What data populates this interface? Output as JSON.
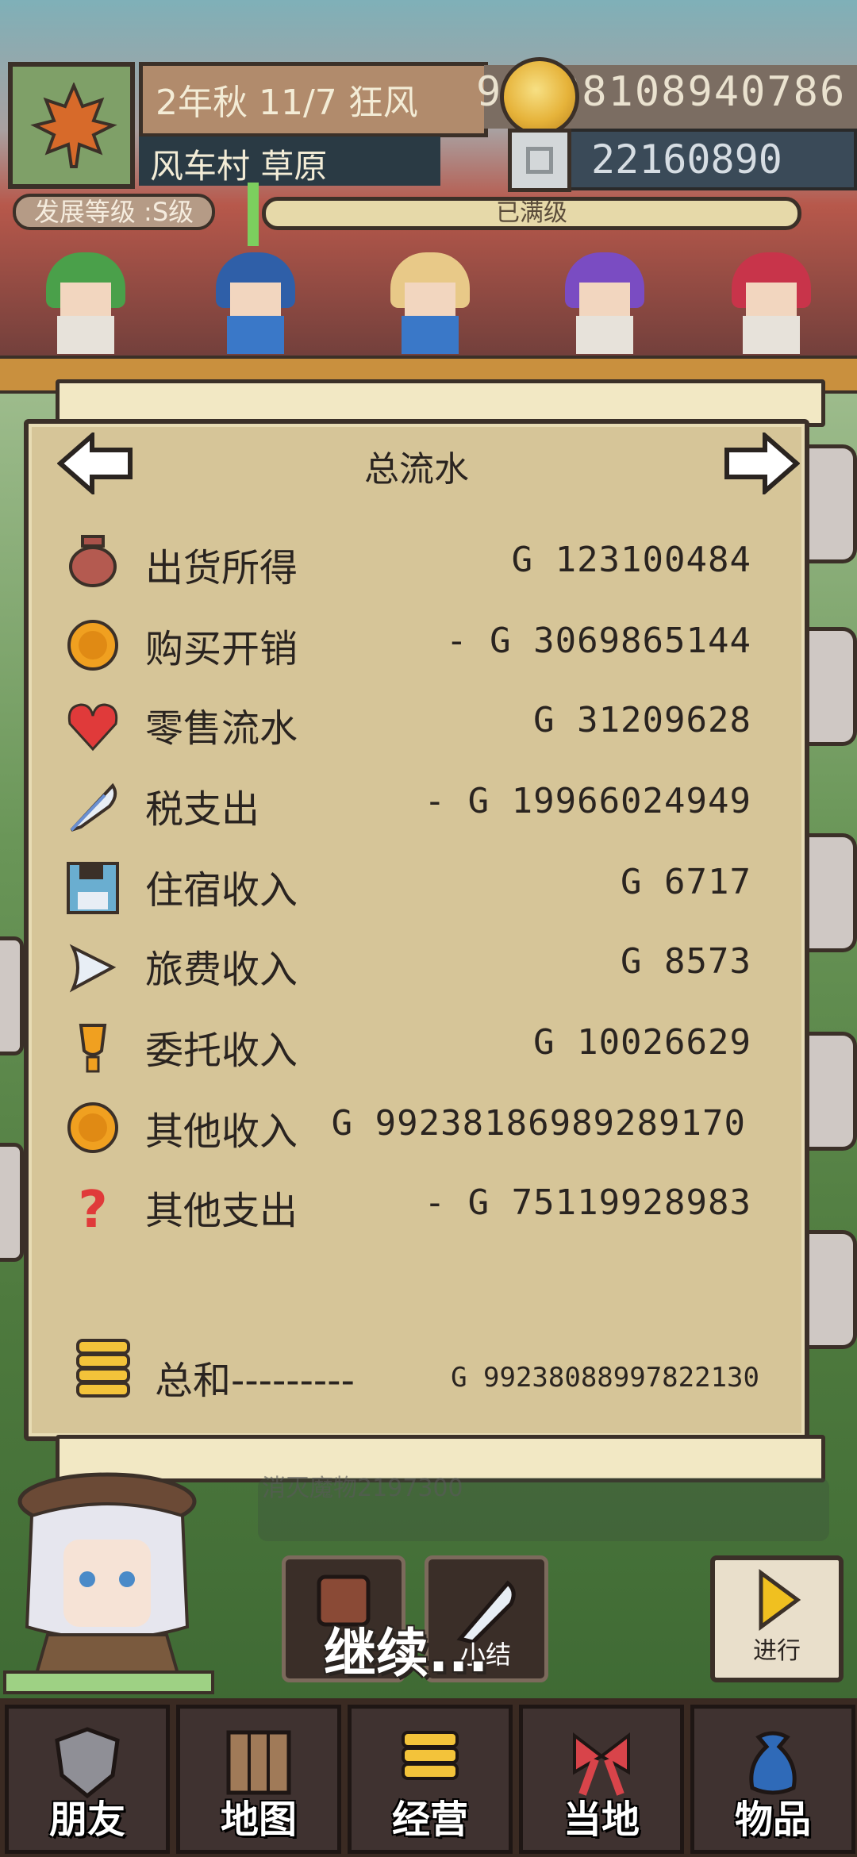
{
  "header": {
    "date": "2年秋 11/7 狂风",
    "location": "风车村 草原",
    "gold": "992381089407​86",
    "silver": "22160890",
    "dev_level": "发展等级 :S级",
    "level_bar": "已满级"
  },
  "panel": {
    "title": "总流水",
    "rows": [
      {
        "label": "出货所得",
        "value": "G 123100484",
        "icon": "pot-icon"
      },
      {
        "label": "购买开销",
        "value": "- G 3069865144",
        "icon": "coin-icon"
      },
      {
        "label": "零售流水",
        "value": "G 31209628",
        "icon": "heart-icon"
      },
      {
        "label": "税支出",
        "value": "- G 19966024949",
        "icon": "feather-icon"
      },
      {
        "label": "住宿收入",
        "value": "G 6717",
        "icon": "floppy-icon"
      },
      {
        "label": "旅费收入",
        "value": "G 8573",
        "icon": "wing-icon"
      },
      {
        "label": "委托收入",
        "value": "G 10026629",
        "icon": "trophy-icon"
      },
      {
        "label": "其他收入",
        "value": "G 99238186989289170",
        "icon": "coin-icon"
      },
      {
        "label": "其他支出",
        "value": "- G 75119928983",
        "icon": "question-icon"
      }
    ],
    "total_label": "总和---------",
    "total_value": "G 99238088997822130"
  },
  "lower": {
    "task_text": "消灭魔物2197300",
    "continue": "继续...",
    "summary_label": "小结",
    "proceed_label": "进行"
  },
  "nav": [
    {
      "label": "朋友",
      "icon": "shield-icon"
    },
    {
      "label": "地图",
      "icon": "map-icon"
    },
    {
      "label": "经营",
      "icon": "coins-stack-icon"
    },
    {
      "label": "当地",
      "icon": "ribbon-icon"
    },
    {
      "label": "物品",
      "icon": "bag-icon"
    }
  ],
  "colors": {
    "panel_bg": "#d6c598",
    "border": "#3b3028",
    "text": "#2a2420"
  }
}
